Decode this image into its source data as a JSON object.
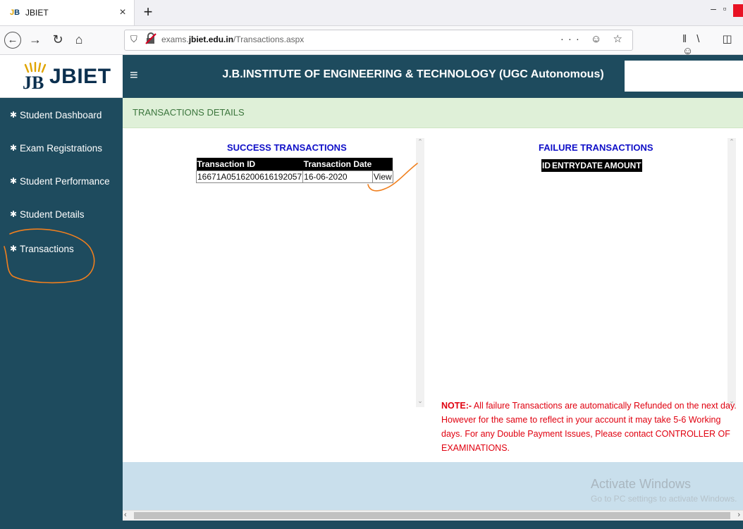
{
  "browser": {
    "tab_title": "JBIET",
    "tab_close": "×",
    "new_tab": "+",
    "url_domain_prefix": "exams.",
    "url_domain": "jbiet.edu.in",
    "url_path": "/Transactions.aspx",
    "url_actions": "··· ☺ ☆",
    "toolbar_icons": "ǁ\\ ◫ ☺"
  },
  "logo": {
    "text": "JBIET",
    "favicon_text": "JB"
  },
  "header": {
    "title": "J.B.INSTITUTE OF ENGINEERING & TECHNOLOGY (UGC Autonomous)",
    "menu_icon": "≡"
  },
  "sidebar": {
    "items": [
      {
        "label": "Student Dashboard"
      },
      {
        "label": "Exam Registrations"
      },
      {
        "label": "Student Performance"
      },
      {
        "label": "Student Details"
      },
      {
        "label": "Transactions"
      }
    ]
  },
  "breadcrumb": {
    "text": "TRANSACTIONS DETAILS"
  },
  "success": {
    "title": "SUCCESS TRANSACTIONS",
    "headers": [
      "Transaction ID",
      "Transaction Date",
      ""
    ],
    "rows": [
      {
        "id": "16671A0516200616192057",
        "date": "16-06-2020",
        "action": "View"
      }
    ]
  },
  "failure": {
    "title": "FAILURE TRANSACTIONS",
    "headers": [
      "ID",
      "ENTRYDATE",
      "AMOUNT"
    ]
  },
  "note": {
    "label": "NOTE:-",
    "text": " All failure Transactions are automatically Refunded on the next day. However for the same to reflect in your account it may take 5-6 Working days. For any Double Payment Issues, Please contact CONTROLLER OF EXAMINATIONS."
  },
  "watermark": {
    "title": "Activate Windows",
    "subtitle": "Go to PC settings to activate Windows."
  },
  "colors": {
    "sidebar_bg": "#1e4b5e",
    "breadcrumb_bg": "#dff0d8",
    "panel_title": "#1010c8",
    "note_text": "#e0000f",
    "annotation": "#f07f1e"
  }
}
